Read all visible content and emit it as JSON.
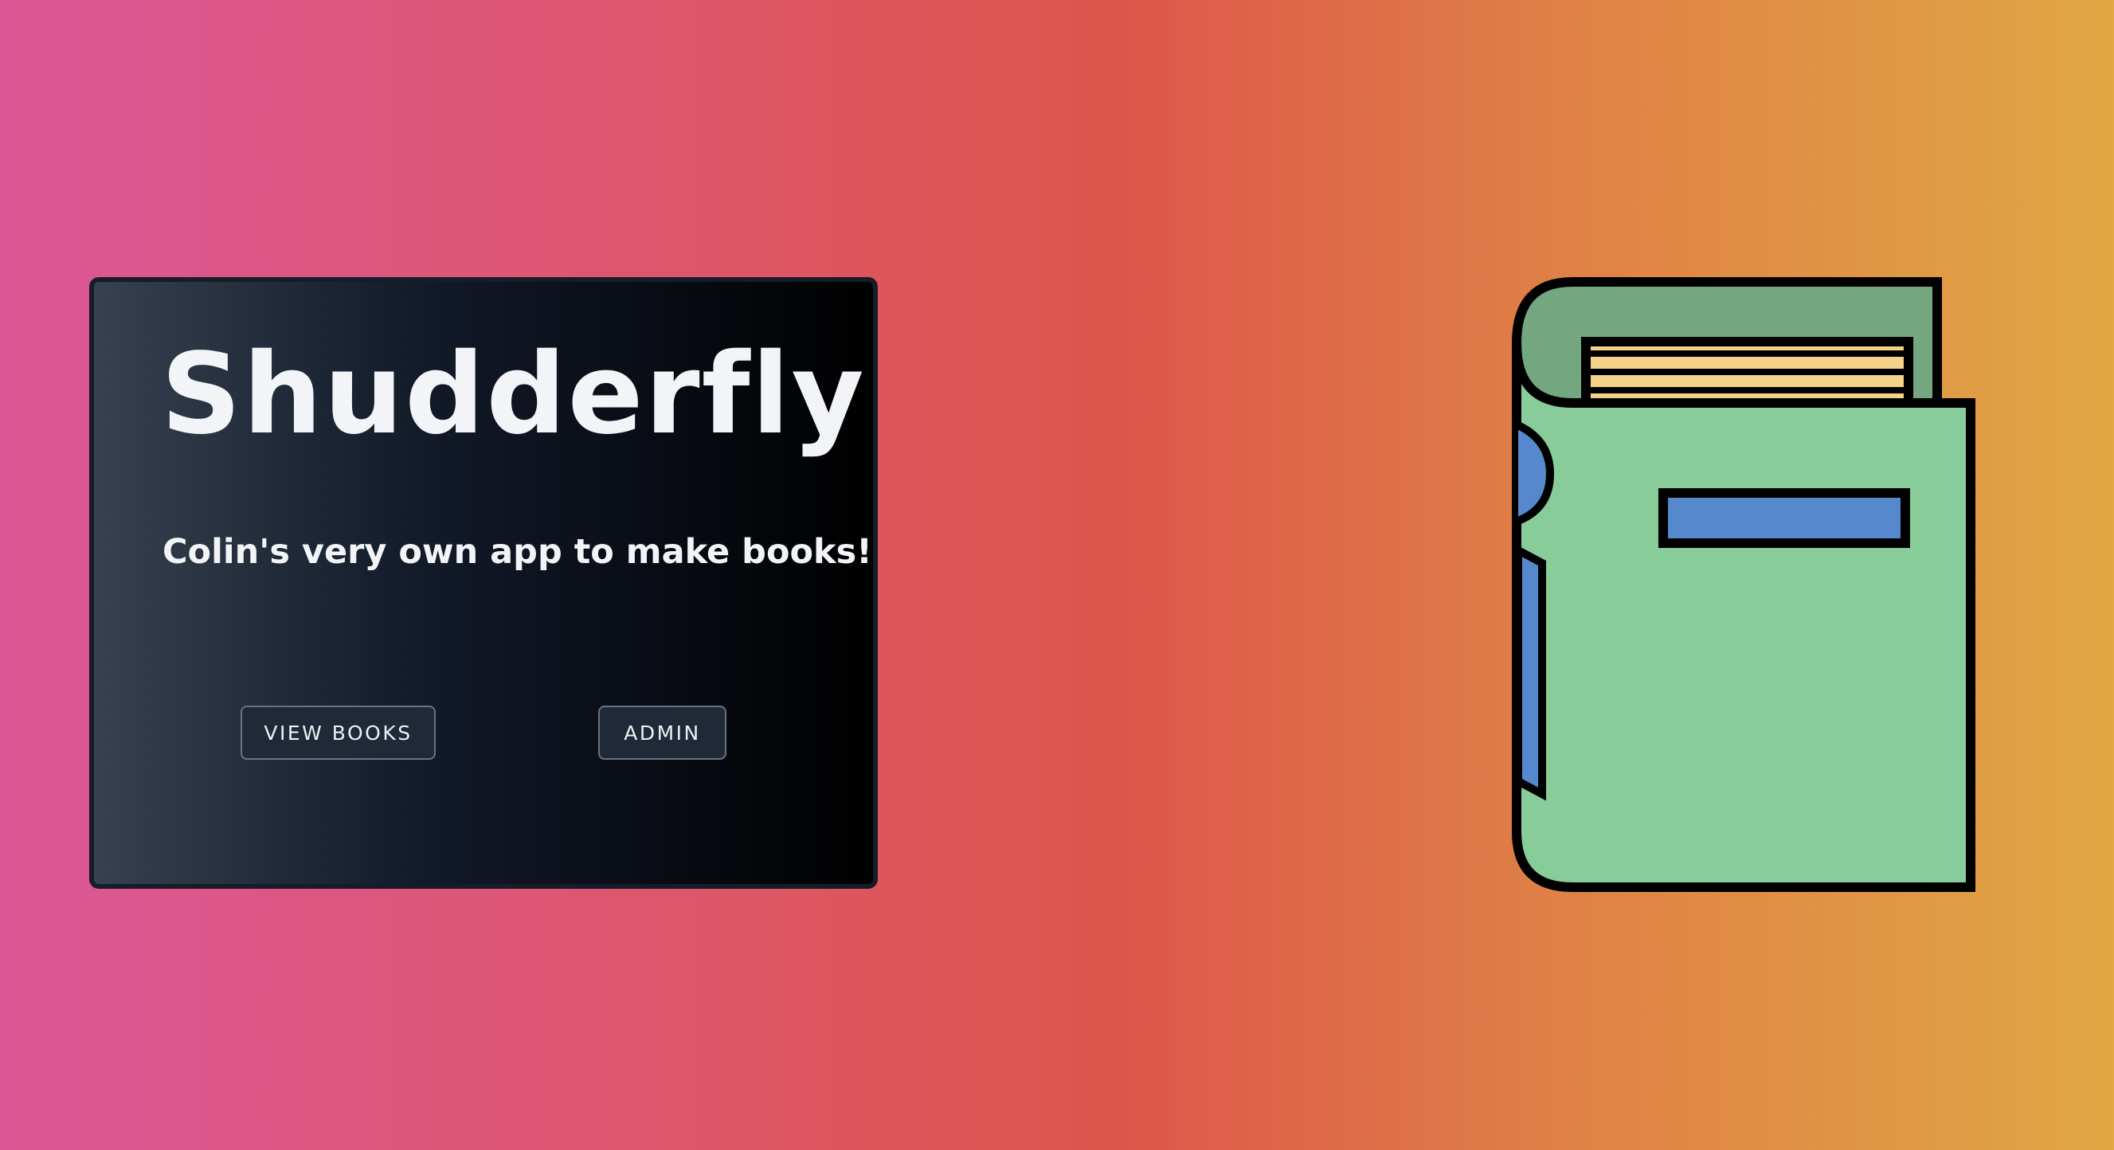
{
  "hero": {
    "title": "Shudderfly",
    "subtitle": "Colin's very own app to make books!",
    "buttons": {
      "view_books": "VIEW BOOKS",
      "admin": "ADMIN"
    }
  },
  "illustration": {
    "icon": "book-icon",
    "colors": {
      "back_cover": "#74a680",
      "front_cover": "#87cc99",
      "pages": "#f4d28a",
      "label_and_spine": "#5588cc",
      "outline": "#000000"
    }
  },
  "theme": {
    "background_gradient": [
      "#db5796",
      "#dd564b",
      "#e1a743"
    ],
    "card_background": [
      "#374151",
      "#000000"
    ]
  }
}
